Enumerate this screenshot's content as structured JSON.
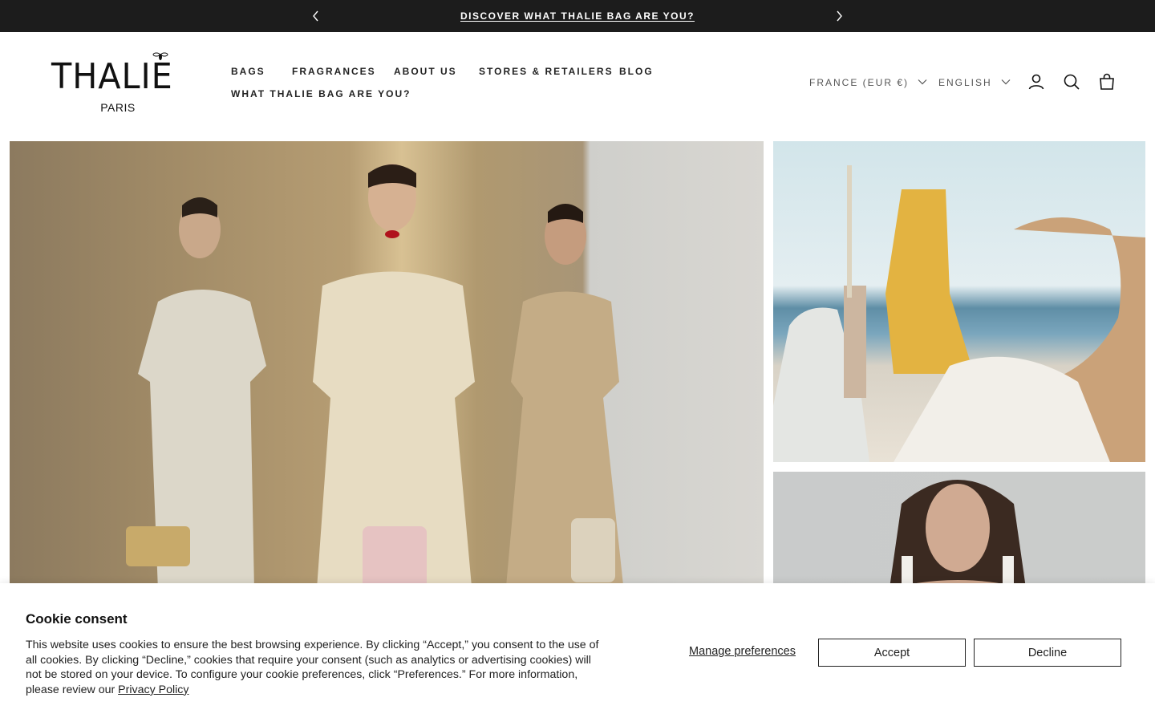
{
  "announcement": {
    "message": "DISCOVER WHAT THALIE BAG ARE YOU?",
    "prev_icon": "chevron-left-icon",
    "next_icon": "chevron-right-icon"
  },
  "header": {
    "logo_text": "THALIE",
    "logo_sub": "PARIS",
    "nav": [
      "BAGS",
      "FRAGRANCES",
      "ABOUT US",
      "STORES & RETAILERS",
      "BLOG",
      "WHAT THALIE BAG ARE YOU?"
    ],
    "country_selector": "FRANCE (EUR €)",
    "language_selector": "ENGLISH",
    "icons": [
      "account-icon",
      "search-icon",
      "cart-bag-icon"
    ]
  },
  "hero": {
    "images": [
      "three-models-with-bags-photo",
      "woman-holding-gold-bag-photo",
      "woman-portrait-photo"
    ]
  },
  "cookie": {
    "title": "Cookie consent",
    "body": "This website uses cookies to ensure the best browsing experience. By clicking “Accept,” you consent to the use of all cookies. By clicking “Decline,” cookies that require your consent (such as analytics or advertising cookies) will not be stored on your device. To configure your cookie preferences, click “Preferences.” For more information, please review our",
    "policy_link": "Privacy Policy",
    "manage_label": "Manage preferences",
    "accept_label": "Accept",
    "decline_label": "Decline"
  },
  "colors": {
    "announcement_bg": "#1c1c1c",
    "text": "#1a1a1a",
    "muted": "#555555"
  }
}
